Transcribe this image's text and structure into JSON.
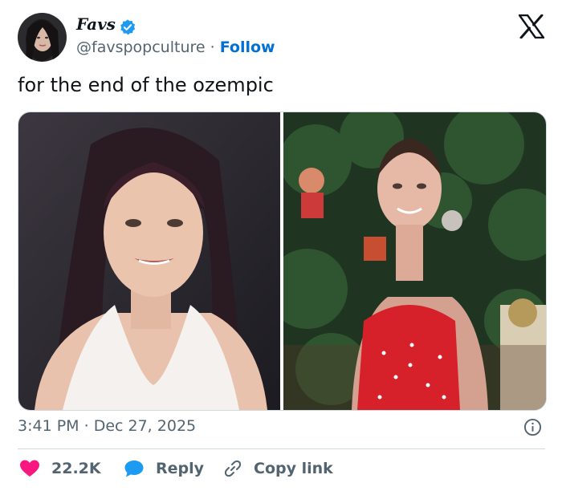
{
  "author": {
    "display_name": "Favs",
    "handle": "@favspopculture",
    "separator": "·",
    "follow_label": "Follow",
    "verified": true,
    "avatar_icon": "avatar-photo"
  },
  "platform": {
    "logo": "x-logo-icon"
  },
  "tweet": {
    "text": "for the end of the ozempic"
  },
  "media": [
    {
      "kind": "photo",
      "description_icon": "photo-left"
    },
    {
      "kind": "photo",
      "description_icon": "photo-right"
    }
  ],
  "meta": {
    "time": "3:41 PM",
    "separator": "·",
    "date": "Dec 27, 2025"
  },
  "actions": {
    "like_count": "22.2K",
    "reply_label": "Reply",
    "copy_link_label": "Copy link"
  },
  "colors": {
    "text": "#0f1419",
    "secondary": "#536471",
    "accent": "#006fd6",
    "like": "#f91880",
    "reply": "#1d9bf0",
    "border": "#cfd9de"
  }
}
